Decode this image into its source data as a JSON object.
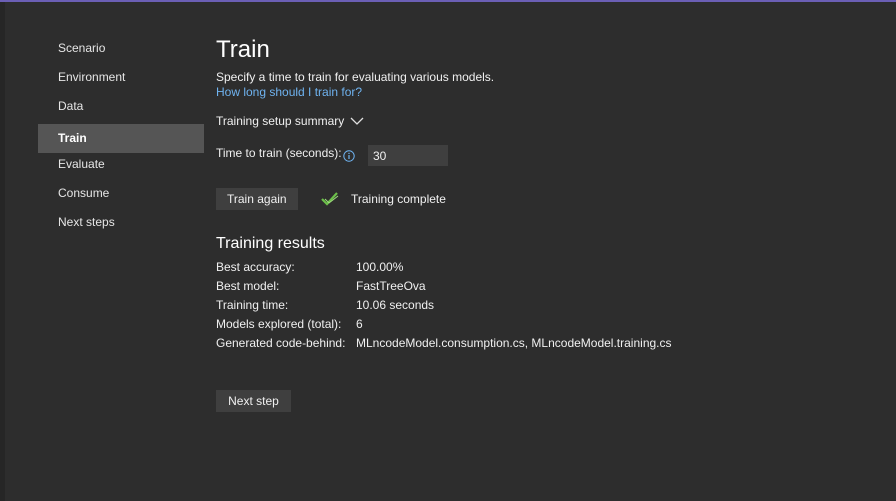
{
  "sidebar": {
    "items": [
      {
        "label": "Scenario"
      },
      {
        "label": "Environment"
      },
      {
        "label": "Data"
      },
      {
        "label": "Train",
        "active": true
      },
      {
        "label": "Evaluate"
      },
      {
        "label": "Consume"
      },
      {
        "label": "Next steps"
      }
    ]
  },
  "page": {
    "title": "Train",
    "subtitle": "Specify a time to train for evaluating various models.",
    "help_link": "How long should I train for?"
  },
  "summary": {
    "label": "Training setup summary",
    "icon": "chevron-down-icon"
  },
  "time_to_train": {
    "label": "Time to train (seconds):",
    "info_icon": "info-icon",
    "value": "30"
  },
  "actions": {
    "train_again_label": "Train again",
    "next_step_label": "Next step"
  },
  "status": {
    "icon": "checkmark-icon",
    "text": "Training complete"
  },
  "results": {
    "heading": "Training results",
    "rows": [
      {
        "key": "Best accuracy:",
        "value": "100.00%"
      },
      {
        "key": "Best model:",
        "value": "FastTreeOva"
      },
      {
        "key": "Training time:",
        "value": "10.06 seconds"
      },
      {
        "key": "Models explored (total):",
        "value": "6"
      },
      {
        "key": "Generated code-behind:",
        "value": "MLncodeModel.consumption.cs, MLncodeModel.training.cs"
      }
    ]
  },
  "colors": {
    "background": "#2d2d2d",
    "active_nav": "#555555",
    "link": "#6fb3f0",
    "success": "#6cc04a",
    "accent": "#6b5fb5"
  }
}
